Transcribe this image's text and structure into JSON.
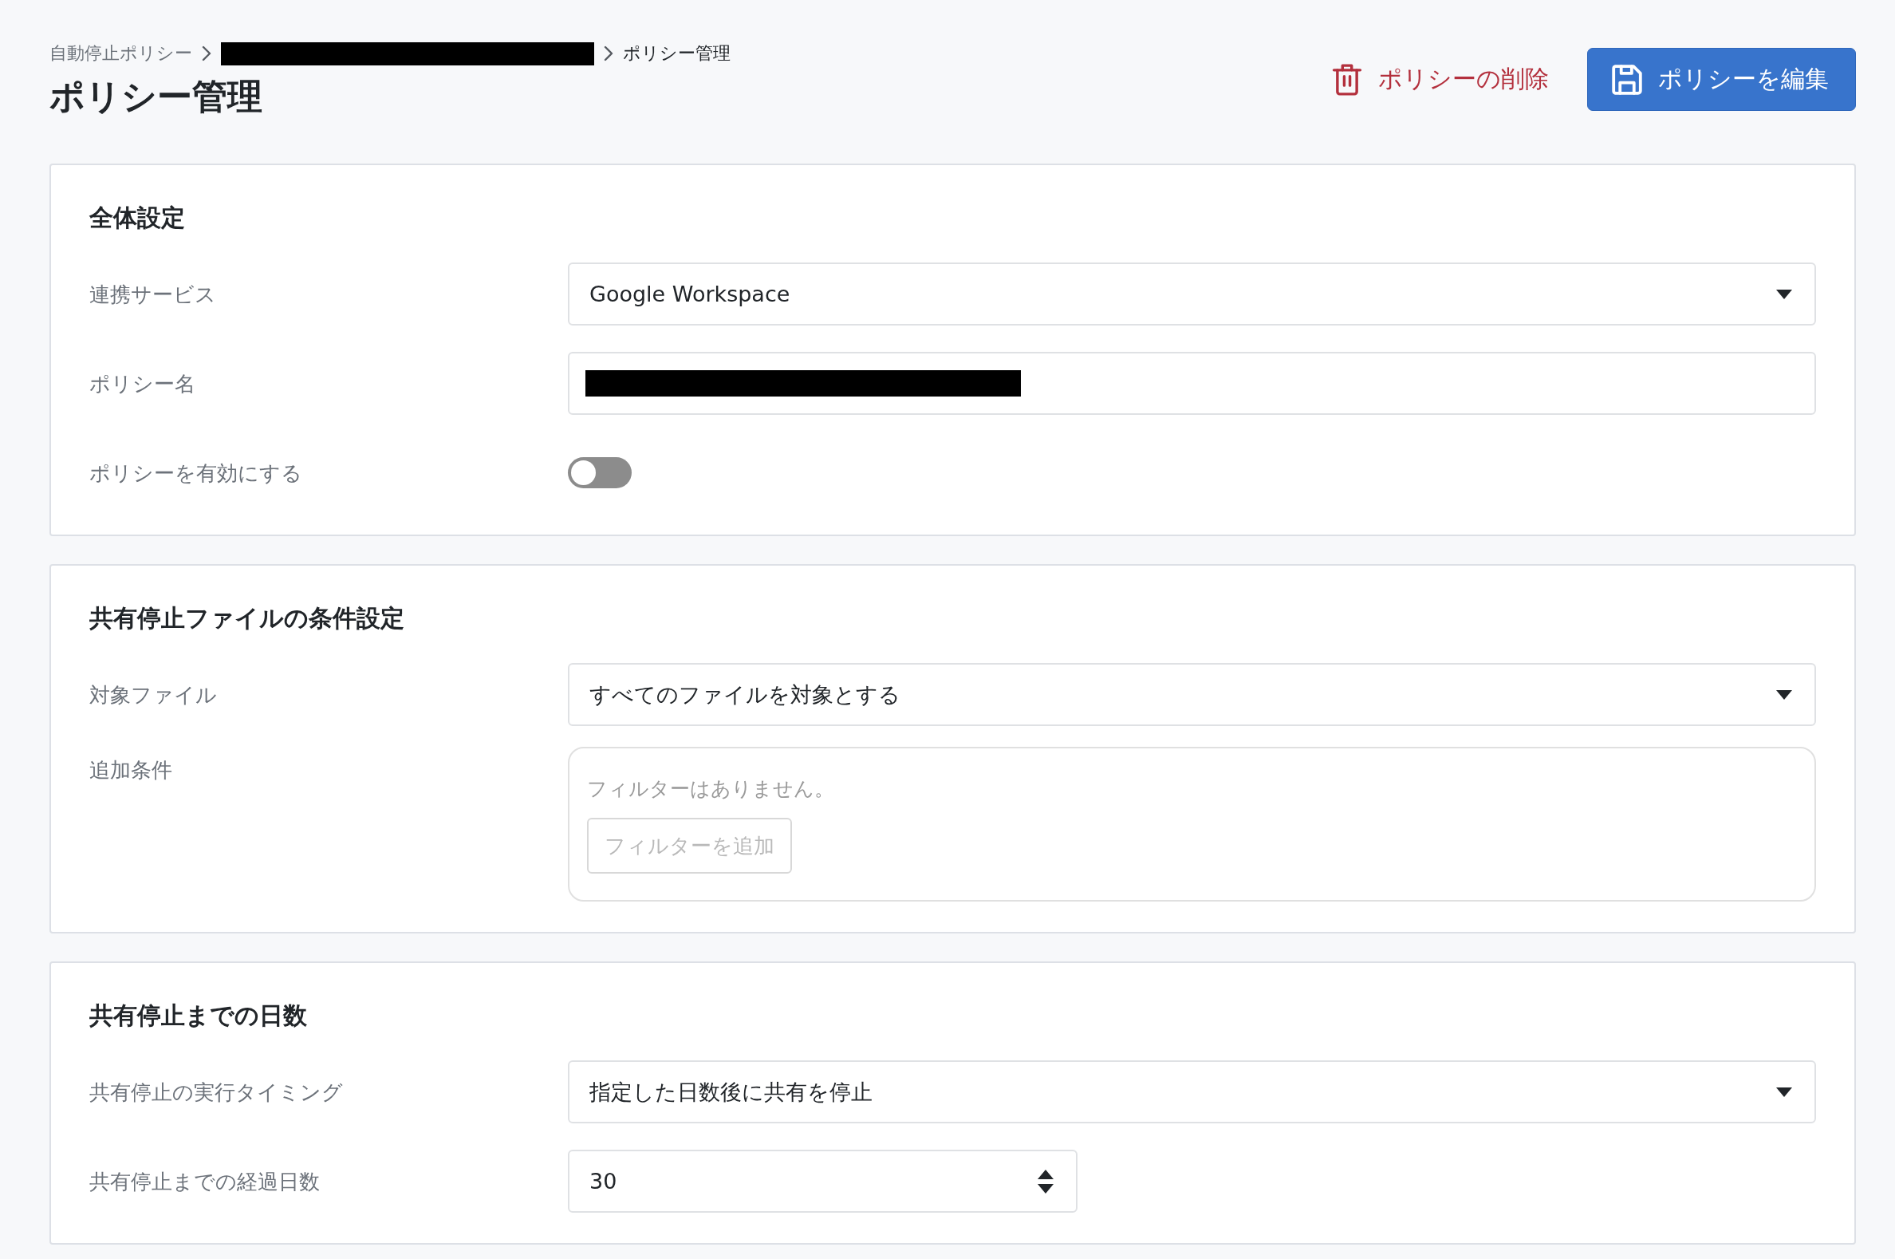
{
  "breadcrumb": [
    {
      "kind": "link",
      "label": "自動停止ポリシー"
    },
    {
      "kind": "redacted"
    },
    {
      "kind": "current",
      "label": "ポリシー管理"
    }
  ],
  "page_title": "ポリシー管理",
  "actions": [
    {
      "kind": "danger",
      "label": "ポリシーの削除"
    },
    {
      "kind": "primary",
      "label": "ポリシーを編集"
    }
  ],
  "sections": [
    {
      "title": "全体設定",
      "fields": [
        {
          "kind": "select",
          "label": "連携サービス",
          "value": "Google Workspace"
        },
        {
          "kind": "text",
          "label": "ポリシー名",
          "redacted": true
        },
        {
          "kind": "toggle",
          "label": "ポリシーを有効にする",
          "on": false
        }
      ]
    },
    {
      "title": "共有停止ファイルの条件設定",
      "fields": [
        {
          "kind": "select",
          "label": "対象ファイル",
          "value": "すべてのファイルを対象とする"
        },
        {
          "kind": "filters",
          "label": "追加条件",
          "empty_message": "フィルターはありません。",
          "button": {
            "label": "フィルターを追加",
            "disabled": true
          }
        }
      ]
    },
    {
      "title": "共有停止までの日数",
      "fields": [
        {
          "kind": "select",
          "label": "共有停止の実行タイミング",
          "value": "指定した日数後に共有を停止"
        },
        {
          "kind": "number",
          "label": "共有停止までの経過日数",
          "value": "30"
        }
      ]
    }
  ]
}
